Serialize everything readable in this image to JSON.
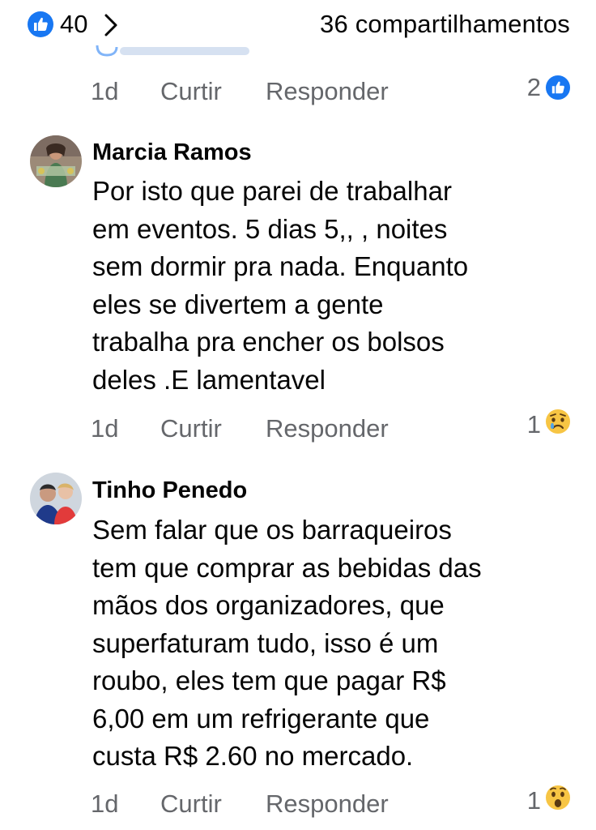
{
  "summary": {
    "likes": "40",
    "shares": "36 compartilhamentos"
  },
  "prev_comment": {
    "time": "1d",
    "like_label": "Curtir",
    "reply_label": "Responder",
    "reaction_count": "2",
    "reaction_icon": "like-icon"
  },
  "comments": [
    {
      "author": "Marcia Ramos",
      "text": "Por isto que parei de trabalhar\nem eventos. 5 dias  5,, , noites\nsem dormir pra nada. Enquanto\neles se divertem a gente\ntrabalha pra encher os bolsos\ndeles .E lamentavel",
      "time": "1d",
      "like_label": "Curtir",
      "reply_label": "Responder",
      "reaction_count": "1",
      "reaction_icon": "sad-icon"
    },
    {
      "author": "Tinho Penedo",
      "text": "Sem falar que os barraqueiros\ntem que comprar as bebidas das\nmãos dos organizadores, que\nsuperfaturam tudo, isso é um\nroubo, eles tem que pagar R$\n6,00 em um refrigerante que\ncusta R$ 2.60 no mercado.",
      "time": "1d",
      "like_label": "Curtir",
      "reply_label": "Responder",
      "reaction_count": "1",
      "reaction_icon": "wow-icon"
    }
  ],
  "colors": {
    "accent": "#1877f2",
    "secondary_text": "#65676b",
    "text": "#050505"
  }
}
